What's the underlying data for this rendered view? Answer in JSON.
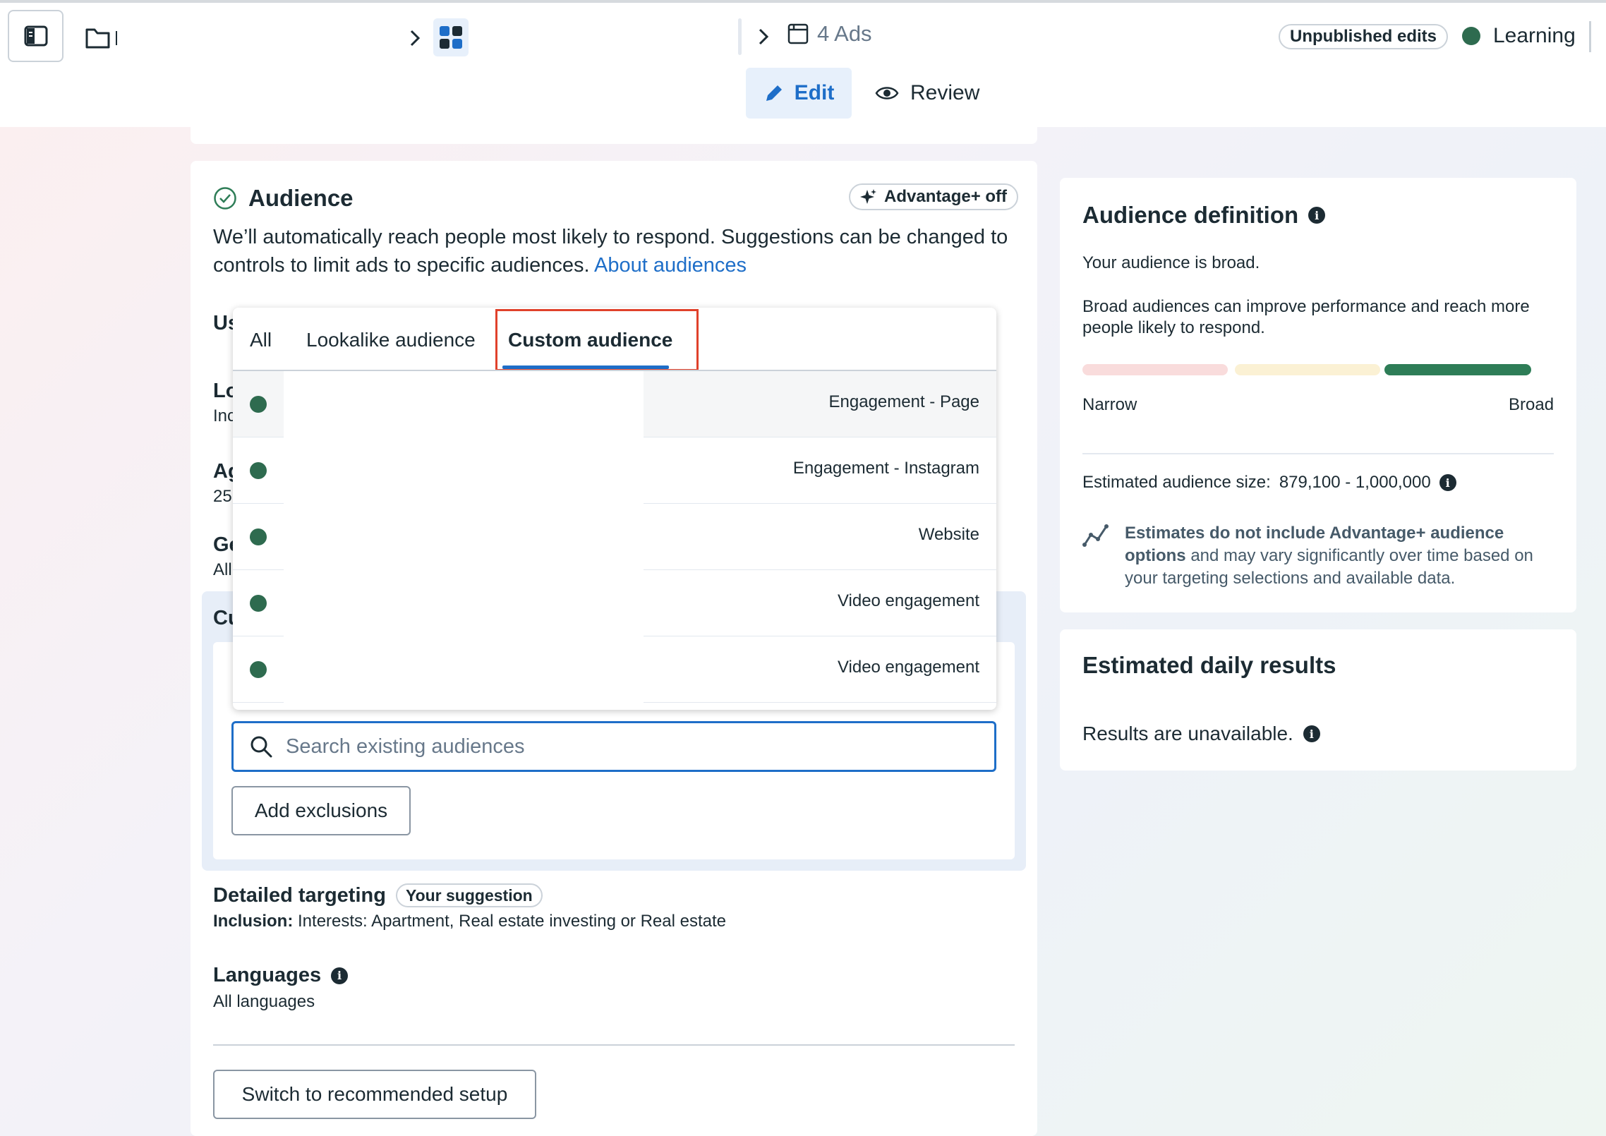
{
  "header": {
    "breadcrumb_ads": "4 Ads",
    "unpublished_label": "Unpublished edits",
    "status_label": "Learning",
    "status_color": "#2e6b4f",
    "edit_label": "Edit",
    "review_label": "Review",
    "icons": [
      "sidebar-toggle-icon",
      "folder-icon",
      "chevron-right-icon",
      "ad-set-grid-icon",
      "ad-icon",
      "pencil-icon",
      "eye-icon"
    ]
  },
  "audience": {
    "title": "Audience",
    "advantage_label": "Advantage+ off",
    "description": "We’ll automatically reach people most likely to respond. Suggestions can be changed to controls to limit ads to specific audiences.",
    "about_link": "About audiences",
    "cut_labels": [
      "Us",
      "Lo",
      "Ag",
      "Ge",
      "Cu"
    ],
    "cut_values": [
      "Inc",
      "25",
      "All"
    ],
    "tabs": [
      "All",
      "Lookalike audience",
      "Custom audience"
    ],
    "active_tab": "Custom audience",
    "options": [
      {
        "type": "Engagement - Page"
      },
      {
        "type": "Engagement - Instagram"
      },
      {
        "type": "Website"
      },
      {
        "type": "Video engagement"
      },
      {
        "type": "Video engagement"
      }
    ],
    "search_placeholder": "Search existing audiences",
    "add_exclusions_label": "Add exclusions",
    "detailed_title": "Detailed targeting",
    "suggestion_pill": "Your suggestion",
    "inclusion_label": "Inclusion:",
    "inclusion_value": "Interests: Apartment, Real estate investing or Real estate",
    "languages_title": "Languages",
    "languages_value": "All languages",
    "switch_label": "Switch to recommended setup"
  },
  "definition": {
    "title": "Audience definition",
    "broad_text": "Your audience is broad.",
    "broad_detail": "Broad audiences can improve performance and reach more people likely to respond.",
    "narrow_label": "Narrow",
    "broad_label": "Broad",
    "meter_level": "broad",
    "meter_colors": [
      "#f9dcdc",
      "#fbf1d4",
      "#2e7d57"
    ],
    "size_label": "Estimated audience size:",
    "size_value": "879,100 - 1,000,000",
    "note_bold": "Estimates do not include Advantage+ audience options",
    "note_rest": " and may vary significantly over time based on your targeting selections and available data."
  },
  "daily": {
    "title": "Estimated daily results",
    "text": "Results are unavailable."
  }
}
